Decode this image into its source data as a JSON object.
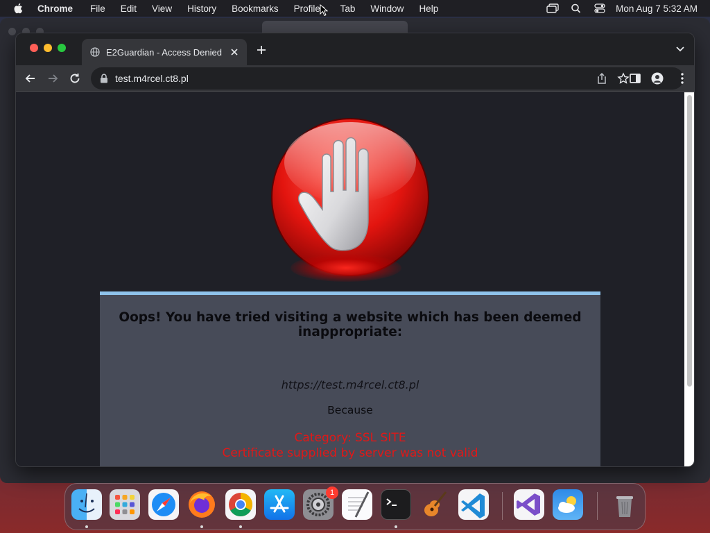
{
  "menubar": {
    "app_name": "Chrome",
    "items": [
      "File",
      "Edit",
      "View",
      "History",
      "Bookmarks",
      "Profiles",
      "Tab",
      "Window",
      "Help"
    ],
    "clock": "Mon Aug 7  5:32 AM"
  },
  "browser": {
    "tab_title": "E2Guardian - Access Denied",
    "url": "test.m4rcel.ct8.pl"
  },
  "page": {
    "headline": "Oops! You have tried visiting a website which has been deemed inappropriate:",
    "blocked_url": "https://test.m4rcel.ct8.pl",
    "because": "Because",
    "category": "Category: SSL SITE",
    "reason": "Certificate supplied by server was not valid",
    "reason_color": "#e01818",
    "panel_accent": "#8fc3ec"
  },
  "dock": {
    "apps": [
      {
        "name": "Finder",
        "icon": "finder-icon",
        "running": true
      },
      {
        "name": "Launchpad",
        "icon": "launchpad-icon",
        "running": false
      },
      {
        "name": "Safari",
        "icon": "safari-icon",
        "running": false
      },
      {
        "name": "Firefox",
        "icon": "firefox-icon",
        "running": true
      },
      {
        "name": "Google Chrome",
        "icon": "chrome-icon",
        "running": true
      },
      {
        "name": "App Store",
        "icon": "app-store-icon",
        "running": false
      },
      {
        "name": "System Settings",
        "icon": "system-settings-icon",
        "running": false,
        "badge": "1"
      },
      {
        "name": "TextEdit",
        "icon": "textedit-icon",
        "running": false
      },
      {
        "name": "Terminal",
        "icon": "terminal-icon",
        "running": true
      },
      {
        "name": "GarageBand",
        "icon": "garageband-icon",
        "running": false
      },
      {
        "name": "Visual Studio Code",
        "icon": "vscode-icon",
        "running": false
      },
      {
        "name": "Visual Studio",
        "icon": "visual-studio-icon",
        "running": false
      },
      {
        "name": "Weather",
        "icon": "weather-icon",
        "running": false
      },
      {
        "name": "Trash",
        "icon": "trash-icon",
        "running": false
      }
    ]
  }
}
